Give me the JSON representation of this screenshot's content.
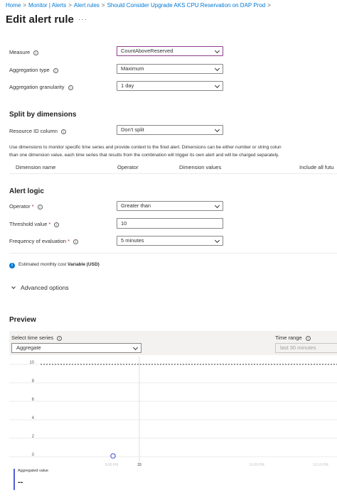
{
  "breadcrumb": [
    {
      "label": "Home"
    },
    {
      "label": "Monitor | Alerts"
    },
    {
      "label": "Alert rules"
    },
    {
      "label": "Should Consider Upgrade AKS CPU Reservation on DAP Prod"
    }
  ],
  "breadcrumb_separator": ">",
  "page_title": "Edit alert rule",
  "more_label": "···",
  "info_glyph": "i",
  "required_marker": "*",
  "fields": {
    "measure": {
      "label": "Measure",
      "value": "CountAboveReserved"
    },
    "aggregation_type": {
      "label": "Aggregation type",
      "value": "Maximum"
    },
    "aggregation_granularity": {
      "label": "Aggregation granularity",
      "value": "1 day"
    }
  },
  "split_by": {
    "title": "Split by dimensions",
    "resource_id_label": "Resource ID column",
    "resource_id_value": "Don't split",
    "description_line1": "Use dimensions to monitor specific time series and provide context to the fired alert. Dimensions can be either number or string colun",
    "description_line2": "than one dimension value, each time series that results from the combination will trigger its own alert and will be charged separately.",
    "columns": [
      "Dimension name",
      "Operator",
      "Dimension values",
      "Include all futu"
    ]
  },
  "alert_logic": {
    "title": "Alert logic",
    "operator_label": "Operator",
    "operator_value": "Greater than",
    "threshold_label": "Threshold value",
    "threshold_value": "10",
    "frequency_label": "Frequency of evaluation",
    "frequency_value": "5 minutes"
  },
  "cost": {
    "prefix": "Estimated monthly cost",
    "value": "Variable (USD)"
  },
  "advanced_options_label": "Advanced options",
  "preview": {
    "title": "Preview",
    "time_series_label": "Select time series",
    "time_series_value": "Aggregate",
    "time_range_label": "Time range",
    "time_range_value": "last 30 minutes"
  },
  "chart_data": {
    "type": "line",
    "title": "",
    "ylim": [
      0,
      10
    ],
    "yticks": [
      "10",
      "8",
      "6",
      "4",
      "2",
      "0"
    ],
    "xticks": [
      "9:00 PM",
      "33",
      "10:00 PM",
      "10:10 PM"
    ],
    "threshold": 10,
    "series": [
      {
        "name": "Aggregated value",
        "values": [
          0
        ]
      }
    ],
    "grid": true,
    "legend_value": "--"
  },
  "colors": {
    "accent": "#0078d4",
    "focus_border": "#8c3d8c",
    "threshold_line": "#605e5c",
    "series": "#4f5fd8"
  }
}
